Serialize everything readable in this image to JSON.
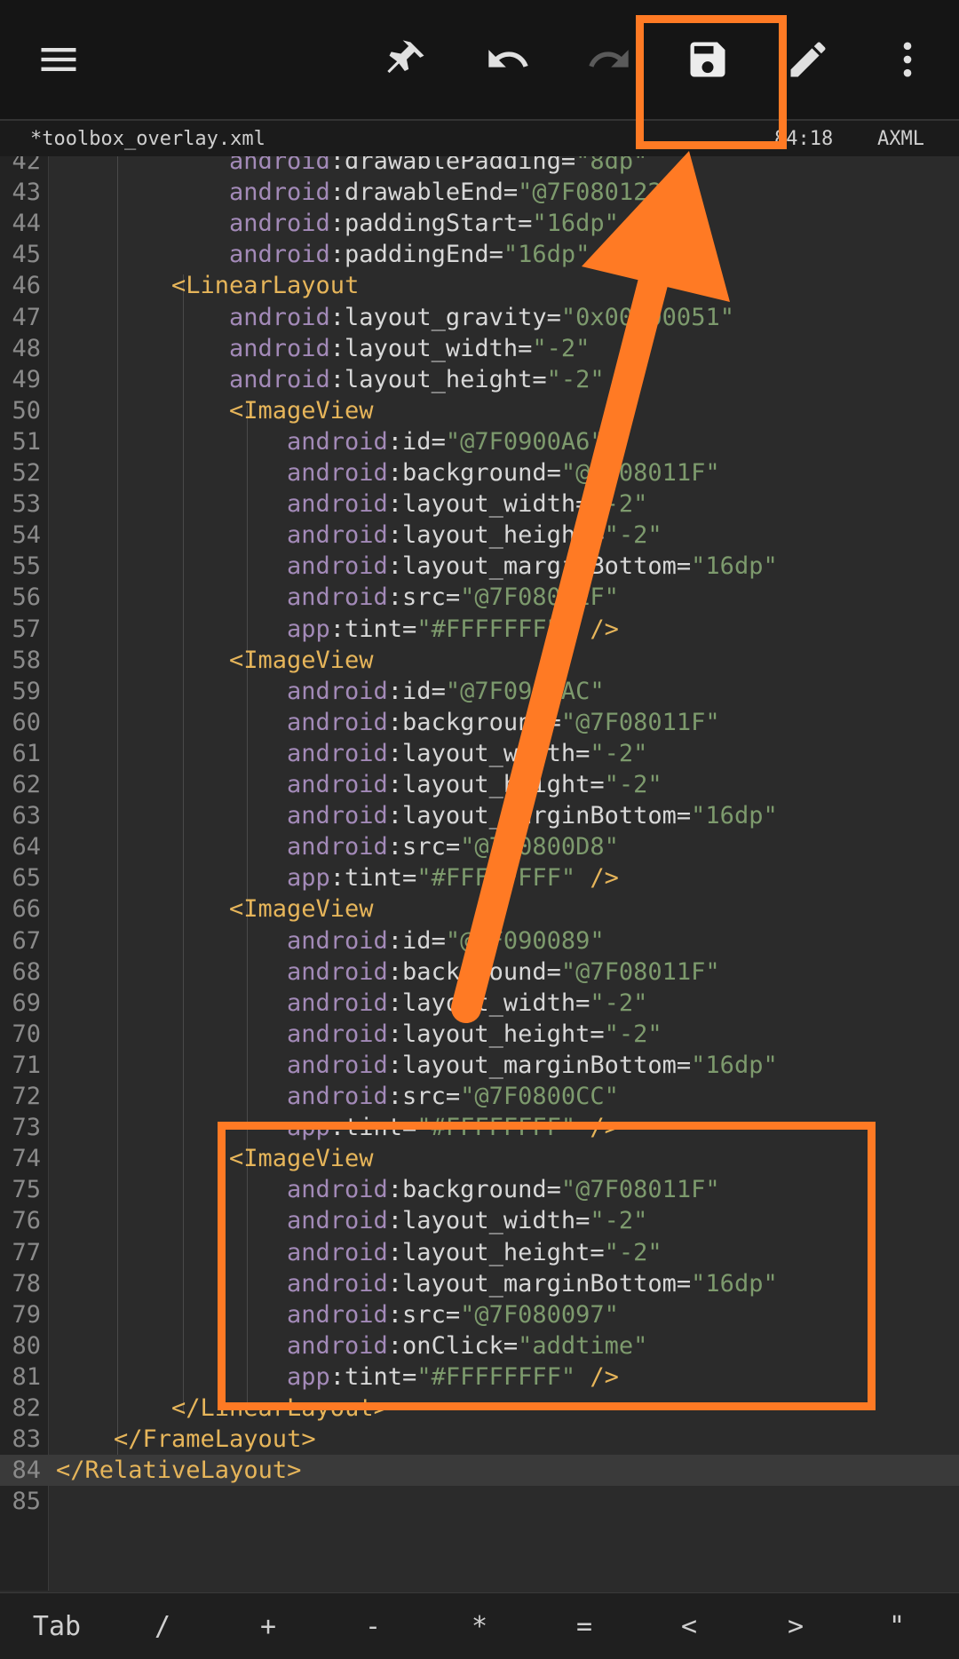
{
  "toolbar": {
    "icons": [
      "menu-icon",
      "pin-icon",
      "undo-icon",
      "redo-icon",
      "save-icon",
      "edit-icon",
      "more-vert-icon"
    ]
  },
  "fileinfo": {
    "filename": "*toolbox_overlay.xml",
    "position": "84:18",
    "mode": "AXML"
  },
  "lines": [
    {
      "n": "42",
      "indent": 3,
      "parts": [
        [
          "ns",
          "android"
        ],
        [
          "attr",
          ":drawablePadding="
        ],
        [
          "str",
          "\"8dp\""
        ]
      ]
    },
    {
      "n": "43",
      "indent": 3,
      "parts": [
        [
          "ns",
          "android"
        ],
        [
          "attr",
          ":drawableEnd="
        ],
        [
          "str",
          "\"@7F080122\""
        ]
      ]
    },
    {
      "n": "44",
      "indent": 3,
      "parts": [
        [
          "ns",
          "android"
        ],
        [
          "attr",
          ":paddingStart="
        ],
        [
          "str",
          "\"16dp\""
        ]
      ]
    },
    {
      "n": "45",
      "indent": 3,
      "parts": [
        [
          "ns",
          "android"
        ],
        [
          "attr",
          ":paddingEnd="
        ],
        [
          "str",
          "\"16dp\""
        ]
      ]
    },
    {
      "n": "46",
      "indent": 2,
      "parts": [
        [
          "tag",
          "<LinearLayout"
        ]
      ]
    },
    {
      "n": "47",
      "indent": 3,
      "parts": [
        [
          "ns",
          "android"
        ],
        [
          "attr",
          ":layout_gravity="
        ],
        [
          "str",
          "\"0x00000051\""
        ]
      ]
    },
    {
      "n": "48",
      "indent": 3,
      "parts": [
        [
          "ns",
          "android"
        ],
        [
          "attr",
          ":layout_width="
        ],
        [
          "str",
          "\"-2\""
        ]
      ]
    },
    {
      "n": "49",
      "indent": 3,
      "parts": [
        [
          "ns",
          "android"
        ],
        [
          "attr",
          ":layout_height="
        ],
        [
          "str",
          "\"-2\""
        ],
        [
          "tag",
          " >"
        ]
      ]
    },
    {
      "n": "50",
      "indent": 3,
      "parts": [
        [
          "tag",
          "<ImageView"
        ]
      ]
    },
    {
      "n": "51",
      "indent": 4,
      "parts": [
        [
          "ns",
          "android"
        ],
        [
          "attr",
          ":id="
        ],
        [
          "str",
          "\"@7F0900A6\""
        ]
      ]
    },
    {
      "n": "52",
      "indent": 4,
      "parts": [
        [
          "ns",
          "android"
        ],
        [
          "attr",
          ":background="
        ],
        [
          "str",
          "\"@7F08011F\""
        ]
      ]
    },
    {
      "n": "53",
      "indent": 4,
      "parts": [
        [
          "ns",
          "android"
        ],
        [
          "attr",
          ":layout_width="
        ],
        [
          "str",
          "\"-2\""
        ]
      ]
    },
    {
      "n": "54",
      "indent": 4,
      "parts": [
        [
          "ns",
          "android"
        ],
        [
          "attr",
          ":layout_height="
        ],
        [
          "str",
          "\"-2\""
        ]
      ]
    },
    {
      "n": "55",
      "indent": 4,
      "parts": [
        [
          "ns",
          "android"
        ],
        [
          "attr",
          ":layout_marginBottom="
        ],
        [
          "str",
          "\"16dp\""
        ]
      ]
    },
    {
      "n": "56",
      "indent": 4,
      "parts": [
        [
          "ns",
          "android"
        ],
        [
          "attr",
          ":src="
        ],
        [
          "str",
          "\"@7F0800EF\""
        ]
      ]
    },
    {
      "n": "57",
      "indent": 4,
      "parts": [
        [
          "ns",
          "app"
        ],
        [
          "attr",
          ":tint="
        ],
        [
          "str",
          "\"#FFFFFFFF\""
        ],
        [
          "tag",
          " />"
        ]
      ]
    },
    {
      "n": "58",
      "indent": 3,
      "parts": [
        [
          "tag",
          "<ImageView"
        ]
      ]
    },
    {
      "n": "59",
      "indent": 4,
      "parts": [
        [
          "ns",
          "android"
        ],
        [
          "attr",
          ":id="
        ],
        [
          "str",
          "\"@7F0900AC\""
        ]
      ]
    },
    {
      "n": "60",
      "indent": 4,
      "parts": [
        [
          "ns",
          "android"
        ],
        [
          "attr",
          ":background="
        ],
        [
          "str",
          "\"@7F08011F\""
        ]
      ]
    },
    {
      "n": "61",
      "indent": 4,
      "parts": [
        [
          "ns",
          "android"
        ],
        [
          "attr",
          ":layout_width="
        ],
        [
          "str",
          "\"-2\""
        ]
      ]
    },
    {
      "n": "62",
      "indent": 4,
      "parts": [
        [
          "ns",
          "android"
        ],
        [
          "attr",
          ":layout_height="
        ],
        [
          "str",
          "\"-2\""
        ]
      ]
    },
    {
      "n": "63",
      "indent": 4,
      "parts": [
        [
          "ns",
          "android"
        ],
        [
          "attr",
          ":layout_marginBottom="
        ],
        [
          "str",
          "\"16dp\""
        ]
      ]
    },
    {
      "n": "64",
      "indent": 4,
      "parts": [
        [
          "ns",
          "android"
        ],
        [
          "attr",
          ":src="
        ],
        [
          "str",
          "\"@7F0800D8\""
        ]
      ]
    },
    {
      "n": "65",
      "indent": 4,
      "parts": [
        [
          "ns",
          "app"
        ],
        [
          "attr",
          ":tint="
        ],
        [
          "str",
          "\"#FFFFFFFF\""
        ],
        [
          "tag",
          " />"
        ]
      ]
    },
    {
      "n": "66",
      "indent": 3,
      "parts": [
        [
          "tag",
          "<ImageView"
        ]
      ]
    },
    {
      "n": "67",
      "indent": 4,
      "parts": [
        [
          "ns",
          "android"
        ],
        [
          "attr",
          ":id="
        ],
        [
          "str",
          "\"@7F090089\""
        ]
      ]
    },
    {
      "n": "68",
      "indent": 4,
      "parts": [
        [
          "ns",
          "android"
        ],
        [
          "attr",
          ":background="
        ],
        [
          "str",
          "\"@7F08011F\""
        ]
      ]
    },
    {
      "n": "69",
      "indent": 4,
      "parts": [
        [
          "ns",
          "android"
        ],
        [
          "attr",
          ":layout_width="
        ],
        [
          "str",
          "\"-2\""
        ]
      ]
    },
    {
      "n": "70",
      "indent": 4,
      "parts": [
        [
          "ns",
          "android"
        ],
        [
          "attr",
          ":layout_height="
        ],
        [
          "str",
          "\"-2\""
        ]
      ]
    },
    {
      "n": "71",
      "indent": 4,
      "parts": [
        [
          "ns",
          "android"
        ],
        [
          "attr",
          ":layout_marginBottom="
        ],
        [
          "str",
          "\"16dp\""
        ]
      ]
    },
    {
      "n": "72",
      "indent": 4,
      "parts": [
        [
          "ns",
          "android"
        ],
        [
          "attr",
          ":src="
        ],
        [
          "str",
          "\"@7F0800CC\""
        ]
      ]
    },
    {
      "n": "73",
      "indent": 4,
      "parts": [
        [
          "ns",
          "app"
        ],
        [
          "attr",
          ":tint="
        ],
        [
          "str",
          "\"#FFFFFFFF\""
        ],
        [
          "tag",
          " />"
        ]
      ]
    },
    {
      "n": "74",
      "indent": 3,
      "parts": [
        [
          "tag",
          "<ImageView"
        ]
      ]
    },
    {
      "n": "75",
      "indent": 4,
      "parts": [
        [
          "ns",
          "android"
        ],
        [
          "attr",
          ":background="
        ],
        [
          "str",
          "\"@7F08011F\""
        ]
      ]
    },
    {
      "n": "76",
      "indent": 4,
      "parts": [
        [
          "ns",
          "android"
        ],
        [
          "attr",
          ":layout_width="
        ],
        [
          "str",
          "\"-2\""
        ]
      ]
    },
    {
      "n": "77",
      "indent": 4,
      "parts": [
        [
          "ns",
          "android"
        ],
        [
          "attr",
          ":layout_height="
        ],
        [
          "str",
          "\"-2\""
        ]
      ]
    },
    {
      "n": "78",
      "indent": 4,
      "parts": [
        [
          "ns",
          "android"
        ],
        [
          "attr",
          ":layout_marginBottom="
        ],
        [
          "str",
          "\"16dp\""
        ]
      ]
    },
    {
      "n": "79",
      "indent": 4,
      "parts": [
        [
          "ns",
          "android"
        ],
        [
          "attr",
          ":src="
        ],
        [
          "str",
          "\"@7F080097\""
        ]
      ]
    },
    {
      "n": "80",
      "indent": 4,
      "parts": [
        [
          "ns",
          "android"
        ],
        [
          "attr",
          ":onClick="
        ],
        [
          "str",
          "\"addtime\""
        ]
      ]
    },
    {
      "n": "81",
      "indent": 4,
      "parts": [
        [
          "ns",
          "app"
        ],
        [
          "attr",
          ":tint="
        ],
        [
          "str",
          "\"#FFFFFFFF\""
        ],
        [
          "tag",
          " />"
        ]
      ]
    },
    {
      "n": "82",
      "indent": 2,
      "parts": [
        [
          "tag",
          "</LinearLayout>"
        ]
      ]
    },
    {
      "n": "83",
      "indent": 1,
      "parts": [
        [
          "tag",
          "</FrameLayout>"
        ]
      ]
    },
    {
      "n": "84",
      "indent": 0,
      "current": true,
      "parts": [
        [
          "tag",
          "</RelativeLayout>"
        ]
      ]
    },
    {
      "n": "85",
      "indent": 0,
      "parts": []
    }
  ],
  "keys": [
    "Tab",
    "/",
    "+",
    "-",
    "*",
    "=",
    "<",
    ">",
    "\""
  ],
  "colors": {
    "annotation": "#ff7a24",
    "toolbar": "#151515",
    "editor": "#2b2b2b"
  }
}
